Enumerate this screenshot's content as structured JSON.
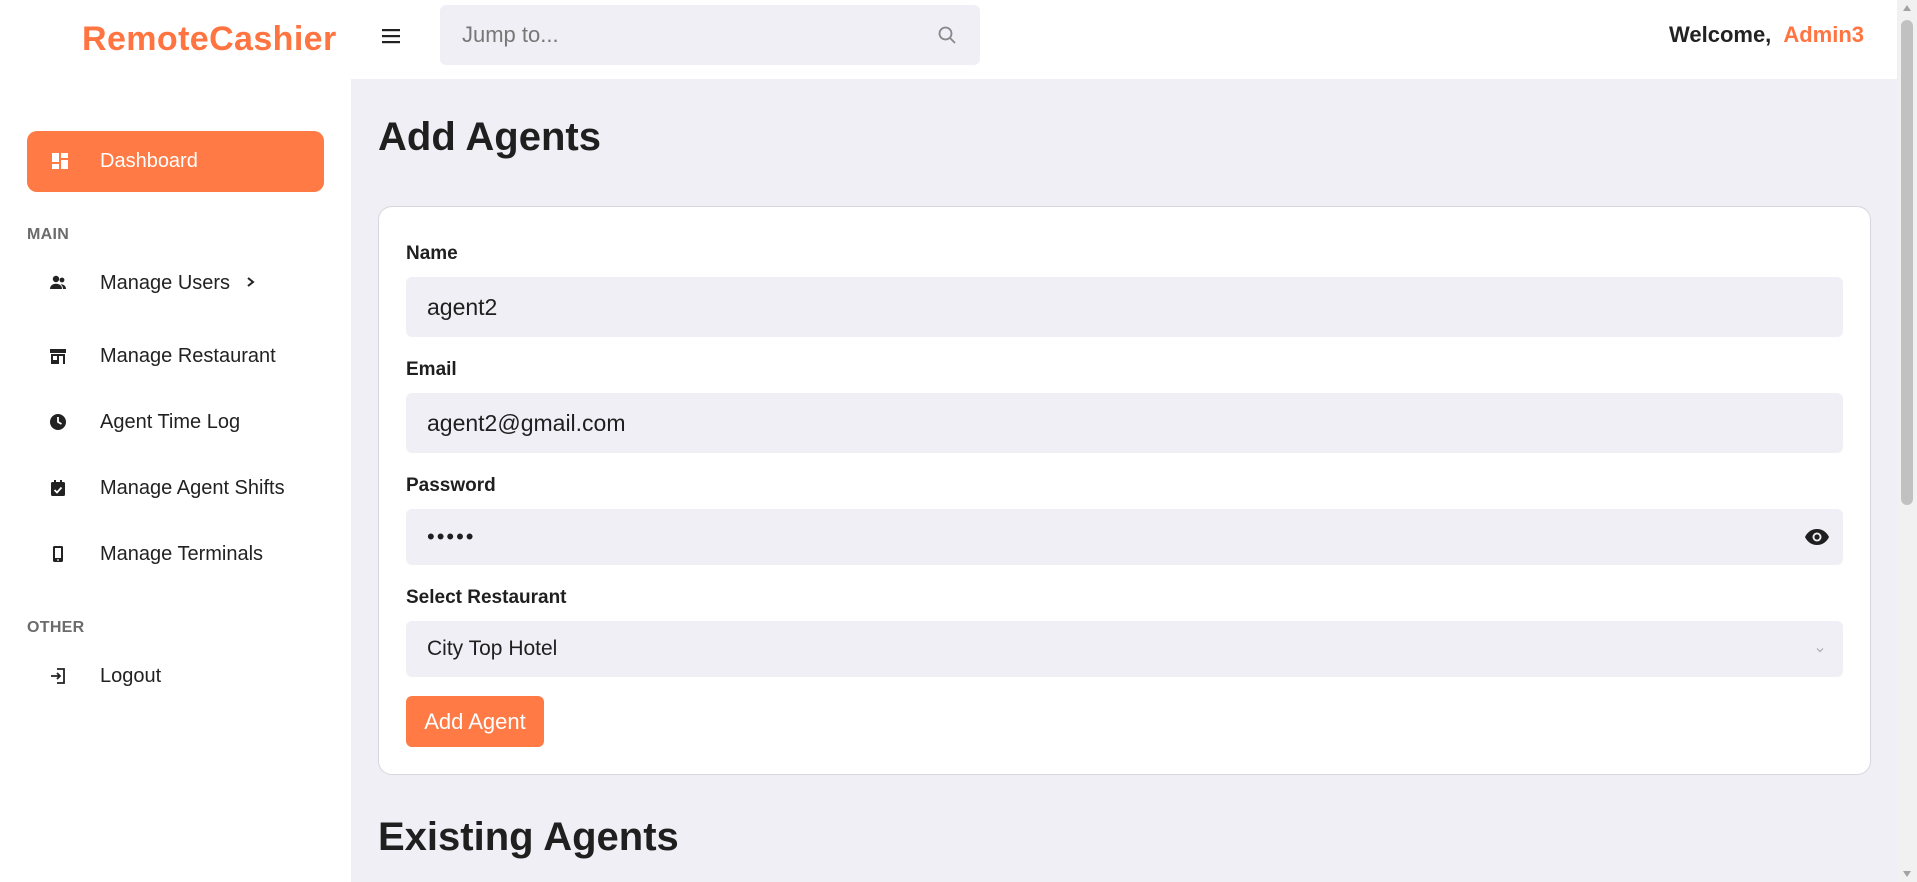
{
  "app": {
    "brand": "RemoteCashier"
  },
  "topbar": {
    "search_placeholder": "Jump to...",
    "welcome_text": "Welcome,",
    "username": "Admin3"
  },
  "sidebar": {
    "active_item": {
      "label": "Dashboard",
      "icon": "dashboard-icon"
    },
    "sections": [
      {
        "label": "MAIN",
        "items": [
          {
            "label": "Manage Users",
            "icon": "users-icon",
            "has_submenu": true
          },
          {
            "label": "Manage Restaurant",
            "icon": "store-icon"
          },
          {
            "label": "Agent Time Log",
            "icon": "clock-icon"
          },
          {
            "label": "Manage Agent Shifts",
            "icon": "calendar-check-icon"
          },
          {
            "label": "Manage Terminals",
            "icon": "phone-icon"
          }
        ]
      },
      {
        "label": "OTHER",
        "items": [
          {
            "label": "Logout",
            "icon": "logout-icon"
          }
        ]
      }
    ]
  },
  "main": {
    "title": "Add Agents",
    "form": {
      "name_label": "Name",
      "name_value": "agent2",
      "email_label": "Email",
      "email_value": "agent2@gmail.com",
      "password_label": "Password",
      "password_value": "•••••",
      "restaurant_label": "Select Restaurant",
      "restaurant_value": "City Top Hotel",
      "submit_label": "Add Agent"
    },
    "existing_title": "Existing Agents"
  },
  "colors": {
    "accent": "#ff7a45",
    "brand_text": "#ff7440",
    "page_bg": "#f0eff5",
    "field_bg": "#efeff5"
  }
}
